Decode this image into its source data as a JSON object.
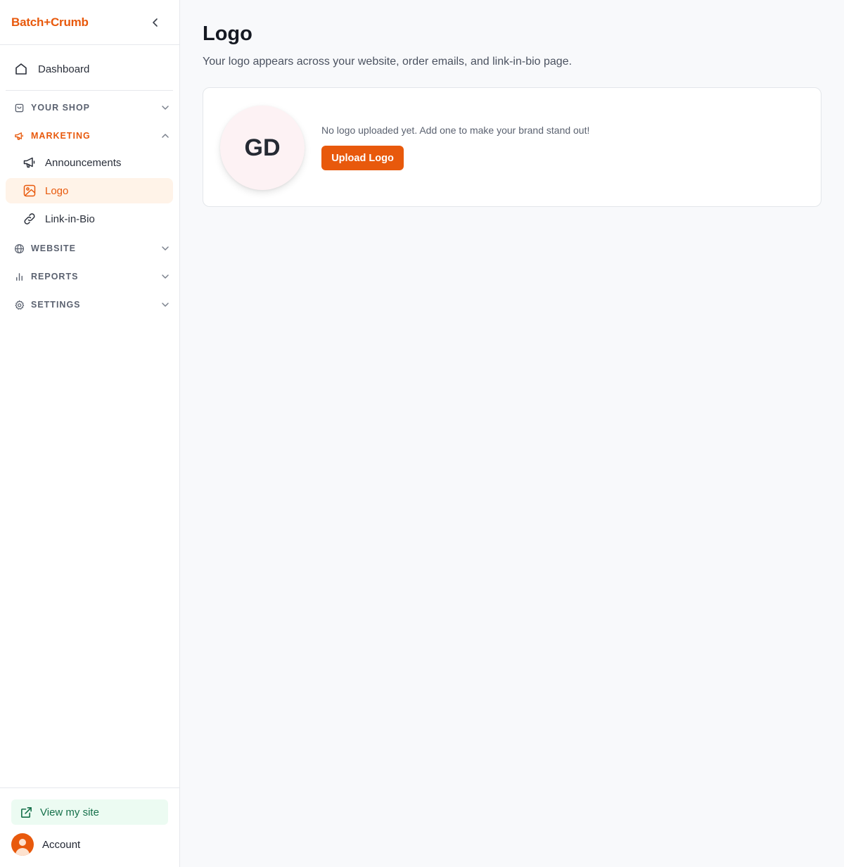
{
  "sidebar": {
    "brand": "Batch+Crumb",
    "dashboard_label": "Dashboard",
    "sections": {
      "your_shop": "YOUR SHOP",
      "marketing": "MARKETING",
      "website": "WEBSITE",
      "reports": "REPORTS",
      "settings": "SETTINGS"
    },
    "marketing_items": [
      {
        "label": "Announcements",
        "icon": "megaphone-icon"
      },
      {
        "label": "Logo",
        "icon": "image-icon",
        "selected": true
      },
      {
        "label": "Link-in-Bio",
        "icon": "link-icon"
      }
    ],
    "view_site_label": "View my site",
    "account_label": "Account"
  },
  "main": {
    "title": "Logo",
    "subtitle": "Your logo appears across your website, order emails, and link-in-bio page.",
    "card": {
      "initials": "GD",
      "message": "No logo uploaded yet. Add one to make your brand stand out!",
      "upload_button": "Upload Logo"
    }
  },
  "colors": {
    "accent": "#e8590c",
    "accent_soft_bg": "#fff3e8",
    "view_site_bg": "#ecfbf2",
    "view_site_text": "#15704a",
    "page_bg": "#f8f9fb"
  }
}
